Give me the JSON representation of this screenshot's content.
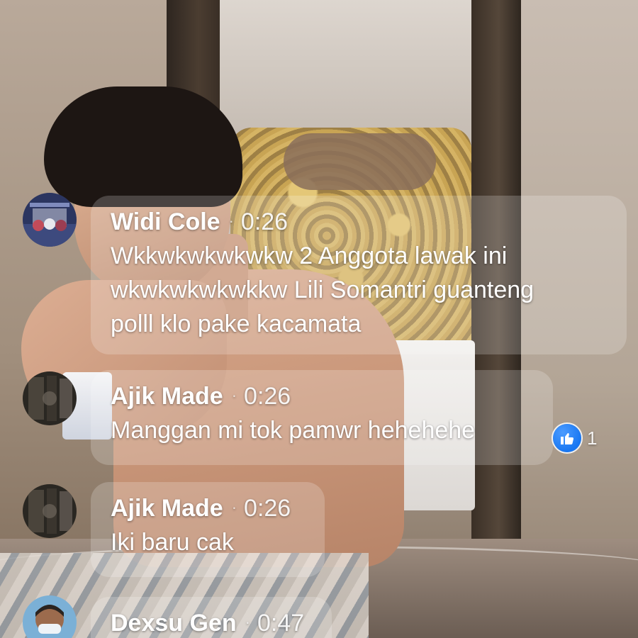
{
  "comments": [
    {
      "author": "Widi Cole",
      "time": "0:26",
      "text_lines": [
        "Wkkwkwkwkwkw 2 Anggota lawak ini",
        "wkwkwkwkwkkw Lili Somantri guanteng",
        "polll klo pake kacamata"
      ],
      "avatar_icon": "band-photo-avatar"
    },
    {
      "author": "Ajik Made",
      "time": "0:26",
      "text_lines": [
        "Manggan mi tok pamwr hehehehe"
      ],
      "avatar_icon": "dark-photo-avatar",
      "reaction": {
        "icon": "like-icon",
        "count": "1",
        "color": "#1877f2"
      }
    },
    {
      "author": "Ajik Made",
      "time": "0:26",
      "text_lines": [
        "Iki baru cak"
      ],
      "avatar_icon": "dark-photo-avatar"
    },
    {
      "author": "Dexsu Gen",
      "time": "0:47",
      "text_lines": [],
      "avatar_icon": "masked-person-avatar"
    }
  ],
  "separator": "·",
  "colors": {
    "bubble": "rgba(255,255,255,0.20)",
    "like_blue": "#1877f2",
    "text": "#ffffff"
  }
}
